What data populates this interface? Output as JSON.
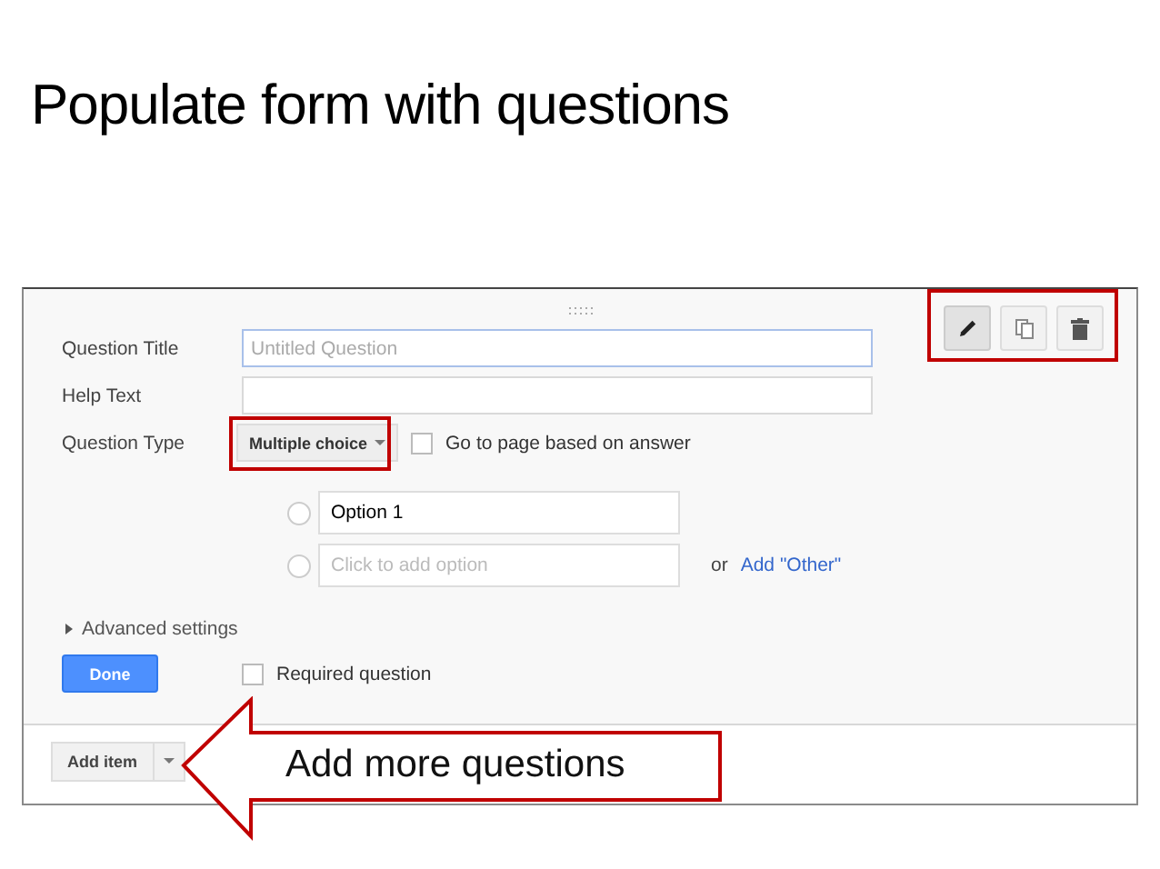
{
  "slide_title": "Populate form with questions",
  "form": {
    "fields": [
      {
        "label": "Question Title",
        "kind": "input",
        "placeholder": "Untitled Question",
        "focused": true
      },
      {
        "label": "Help Text",
        "kind": "input",
        "focused": false
      },
      {
        "label": "Question Type",
        "kind": "select",
        "value": "Multiple choice",
        "checkbox": {
          "label": "Go to page based on answer",
          "checked": false
        }
      }
    ],
    "options": [
      {
        "value": "Option 1",
        "selected": false
      },
      {
        "placeholder": "Click to add option",
        "selected": false,
        "extra_text": "or",
        "extra_link": "Add \"Other\""
      }
    ],
    "advanced_settings": {
      "label": "Advanced settings",
      "expanded": false
    },
    "done_button": "Done",
    "required": {
      "label": "Required question",
      "checked": false
    },
    "toolbar": [
      {
        "kind": "edit",
        "selected": true
      },
      {
        "kind": "copy",
        "selected": false
      },
      {
        "kind": "delete",
        "selected": false
      }
    ]
  },
  "add_item": {
    "label": "Add item"
  },
  "callout": {
    "text": "Add more questions"
  }
}
